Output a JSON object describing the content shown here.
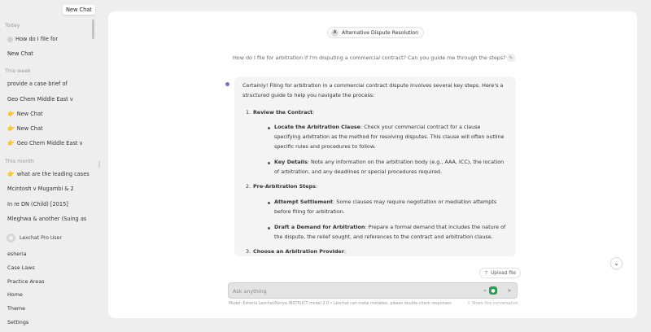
{
  "tooltip": "New Chat",
  "sidebar": {
    "sections": {
      "today": "Today",
      "this_week": "This week",
      "this_month": "This month"
    },
    "today_items": [
      {
        "label": "How do I file for"
      },
      {
        "label": "New Chat"
      }
    ],
    "week_items": [
      {
        "label": "provide a case brief of"
      },
      {
        "label": "Geo Chem Middle East v"
      },
      {
        "label": "New Chat"
      },
      {
        "label": "New Chat"
      },
      {
        "label": "Geo Chem Middle East v"
      }
    ],
    "month_items": [
      {
        "label": "what are the leading cases"
      },
      {
        "label": "Mcintosh v Mugambi & 2"
      },
      {
        "label": "In re DN (Child) [2015]"
      },
      {
        "label": "Mleghwa & another (Suing as"
      }
    ],
    "user": {
      "name": "Lexchat Pro User"
    },
    "bottom_links": [
      "esheria",
      "Case Laws",
      "Practice Areas",
      "Home",
      "Theme",
      "Settings"
    ]
  },
  "main": {
    "topic": {
      "letter": "A",
      "label": "Alternative Dispute Resolution"
    },
    "question": "How do I file for arbitration if I'm disputing a commercial contract? Can you guide me through the steps?",
    "answer": {
      "intro": "Certainly! Filing for arbitration in a commercial contract dispute involves several key steps. Here's a structured guide to help you navigate the process:",
      "steps": [
        {
          "num": "1.",
          "title": "Review the Contract",
          "subs": [
            {
              "bold": "Locate the Arbitration Clause",
              "text": ": Check your commercial contract for a clause specifying arbitration as the method for resolving disputes. This clause will often outline specific rules and procedures to follow."
            },
            {
              "bold": "Key Details",
              "text": ": Note any information on the arbitration body (e.g., AAA, ICC), the location of arbitration, and any deadlines or special procedures required."
            }
          ]
        },
        {
          "num": "2.",
          "title": "Pre-Arbitration Steps",
          "subs": [
            {
              "bold": "Attempt Settlement",
              "text": ": Some clauses may require negotiation or mediation attempts before filing for arbitration."
            },
            {
              "bold": "Draft a Demand for Arbitration",
              "text": ": Prepare a formal demand that includes the nature of the dispute, the relief sought, and references to the contract and arbitration clause."
            }
          ]
        },
        {
          "num": "3.",
          "title": "Choose an Arbitration Provider",
          "subs": []
        }
      ]
    },
    "upload_label": "Upload file",
    "input": {
      "placeholder": "Ask anything",
      "value": ""
    },
    "footer_note": "Model: Esheria Lexchat/Kenya INSTRUCT model 2.0  •  Lexchat can make mistakes, please double-check responses",
    "share_label": "Share this conversation"
  },
  "colors": {
    "page_bg": "#eeeeee",
    "panel_bg": "#ffffff",
    "answer_bg": "#f4f4f4",
    "accent_dot": "#7b6fd6",
    "mic_green": "#2e9a55"
  },
  "icons": {
    "chat_default": "circle-icon",
    "chat_emoji": "hand-pointing-icon",
    "edit": "pencil-icon",
    "scroll": "chevron-down-icon",
    "upload": "filter-icon",
    "attach": "paperclip-icon",
    "mic": "microphone-icon",
    "send": "send-icon",
    "share": "upload-icon"
  }
}
